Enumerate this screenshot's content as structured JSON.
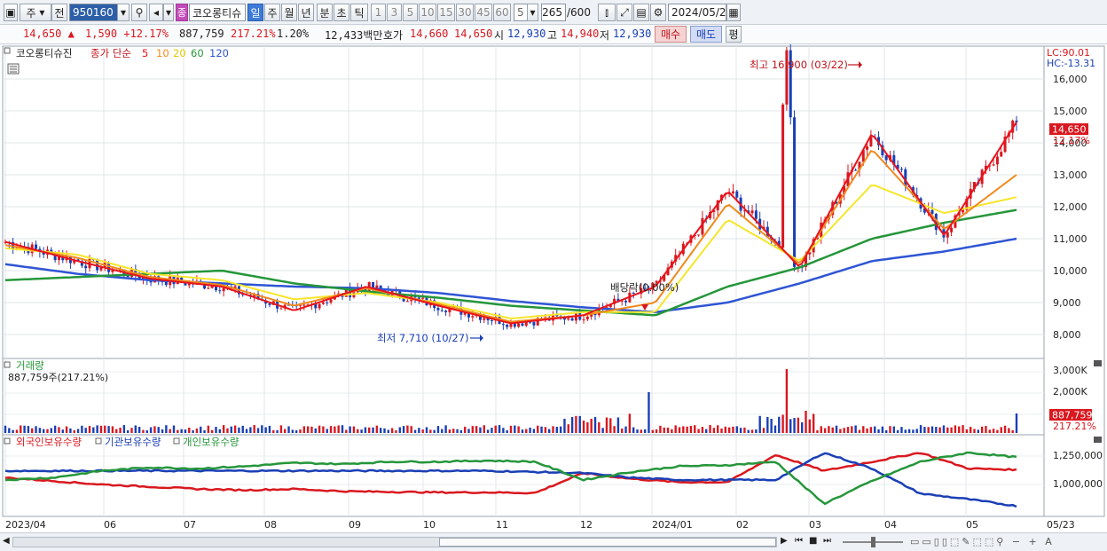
{
  "toolbar": {
    "market": "주",
    "prev_label": "전",
    "code": "950160",
    "stock_badge": "종",
    "stock_name": "코오롱티슈",
    "periods": [
      "일",
      "주",
      "월",
      "년",
      "분",
      "초",
      "틱"
    ],
    "active_period": "일",
    "intervals": [
      "1",
      "3",
      "5",
      "10",
      "15",
      "30",
      "45",
      "60"
    ],
    "interval_value": "5",
    "count": "265",
    "count_total": "/600",
    "date": "2024/05/23"
  },
  "quote": {
    "price": "14,650 ▲",
    "change": "1,590 +12.17%",
    "volume": "887,759",
    "volume_ratio": "217.21%",
    "turnover": "1.20%",
    "amount": "12,433백만",
    "ask_label": "호가",
    "ask": "14,660",
    "bid": "14,650",
    "open_label": "시",
    "open": "12,930",
    "high_label": "고",
    "high": "14,940",
    "low_label": "저",
    "low": "12,930",
    "buy_button": "매수",
    "sell_button": "매도",
    "eval_button": "평"
  },
  "price_panel": {
    "name_label": "코오롱티슈진",
    "ma_label": "종가 단순",
    "ma_periods": [
      "5",
      "10",
      "20",
      "60",
      "120"
    ],
    "lc": "LC:90.01",
    "hc": "HC:-13.31",
    "last_price": "14,650",
    "last_change": "12.17%",
    "y_ticks": [
      "16,000",
      "15,000",
      "14,000",
      "13,000",
      "12,000",
      "11,000",
      "10,000",
      "9,000",
      "8,000"
    ],
    "high_annotation": "최고 16,900 (03/22)",
    "low_annotation": "최저 7,710 (10/27)",
    "dividend_annotation": "배당락(0.00%)"
  },
  "volume_panel": {
    "title": "거래량",
    "value_label": "887,759주(217.21%)",
    "y_ticks": [
      "3,000K",
      "2,000K",
      "1,000K"
    ],
    "last_volume": "887,759",
    "last_ratio": "217.21%"
  },
  "holder_panel": {
    "legend": [
      "외국인보유수량",
      "기관보유수량",
      "개인보유수량"
    ],
    "y_ticks": [
      "1,250,000",
      "1,000,000"
    ]
  },
  "x_axis": {
    "labels": [
      "2023/04",
      "06",
      "07",
      "08",
      "09",
      "10",
      "11",
      "12",
      "2024/01",
      "02",
      "03",
      "04",
      "05",
      "05/23"
    ]
  },
  "colors": {
    "up": "#d9181f",
    "down": "#1a3fb5",
    "ma5": "#e8141c",
    "ma10": "#f08a1c",
    "ma20": "#f5e62a",
    "ma60": "#25963a",
    "ma120": "#2f55d4"
  },
  "chart_data": {
    "type": "line",
    "x": [
      "2023/04",
      "05",
      "06",
      "07",
      "08",
      "09",
      "10",
      "11",
      "12",
      "2024/01",
      "02",
      "03",
      "04",
      "05",
      "05/23"
    ],
    "series": [
      {
        "name": "5",
        "values": [
          10900,
          10300,
          9750,
          9500,
          8750,
          9500,
          8900,
          8350,
          8600,
          9500,
          12500,
          10100,
          14300,
          11100,
          14650
        ]
      },
      {
        "name": "10",
        "values": [
          10800,
          10400,
          9800,
          9550,
          8900,
          9450,
          8950,
          8400,
          8600,
          9000,
          12100,
          10200,
          13800,
          11300,
          13000
        ]
      },
      {
        "name": "20",
        "values": [
          10700,
          10500,
          9900,
          9700,
          9100,
          9300,
          9000,
          8500,
          8700,
          8700,
          11600,
          10300,
          12700,
          11800,
          12300
        ]
      },
      {
        "name": "60",
        "values": [
          9700,
          9800,
          9900,
          10000,
          9600,
          9350,
          9150,
          8900,
          8750,
          8600,
          9500,
          10100,
          11000,
          11500,
          11900
        ]
      },
      {
        "name": "120",
        "values": [
          10200,
          9900,
          9700,
          9600,
          9500,
          9450,
          9300,
          9050,
          8850,
          8700,
          9000,
          9600,
          10300,
          10600,
          11000
        ]
      }
    ],
    "ylim": [
      7500,
      17000
    ],
    "high": {
      "value": 16900,
      "date": "03/22"
    },
    "low": {
      "value": 7710,
      "date": "10/27"
    },
    "grid": true
  }
}
